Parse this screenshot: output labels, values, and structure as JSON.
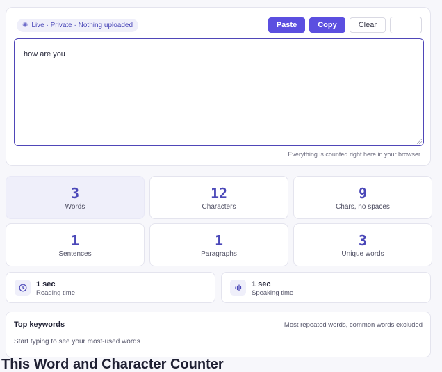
{
  "editor": {
    "badge": "Live · Private · Nothing uploaded",
    "text": "how are you",
    "hint": "Everything is counted right here in your browser."
  },
  "toolbar": {
    "paste_label": "Paste",
    "copy_label": "Copy",
    "clear_label": "Clear"
  },
  "stats": [
    {
      "value": "3",
      "label": "Words"
    },
    {
      "value": "12",
      "label": "Characters"
    },
    {
      "value": "9",
      "label": "Chars, no spaces"
    },
    {
      "value": "1",
      "label": "Sentences"
    },
    {
      "value": "1",
      "label": "Paragraphs"
    },
    {
      "value": "3",
      "label": "Unique words"
    }
  ],
  "times": [
    {
      "value": "1 sec",
      "label": "Reading time",
      "icon": "clock-icon"
    },
    {
      "value": "1 sec",
      "label": "Speaking time",
      "icon": "waveform-icon"
    }
  ],
  "keywords": {
    "title": "Top keywords",
    "note": "Most repeated words, common words excluded",
    "empty": "Start typing to see your most-used words"
  },
  "footer_heading": "This Word and Character Counter",
  "colors": {
    "accent": "#5b4fe0",
    "accent_text": "#4a47b8",
    "accent_soft": "#efeffa"
  }
}
